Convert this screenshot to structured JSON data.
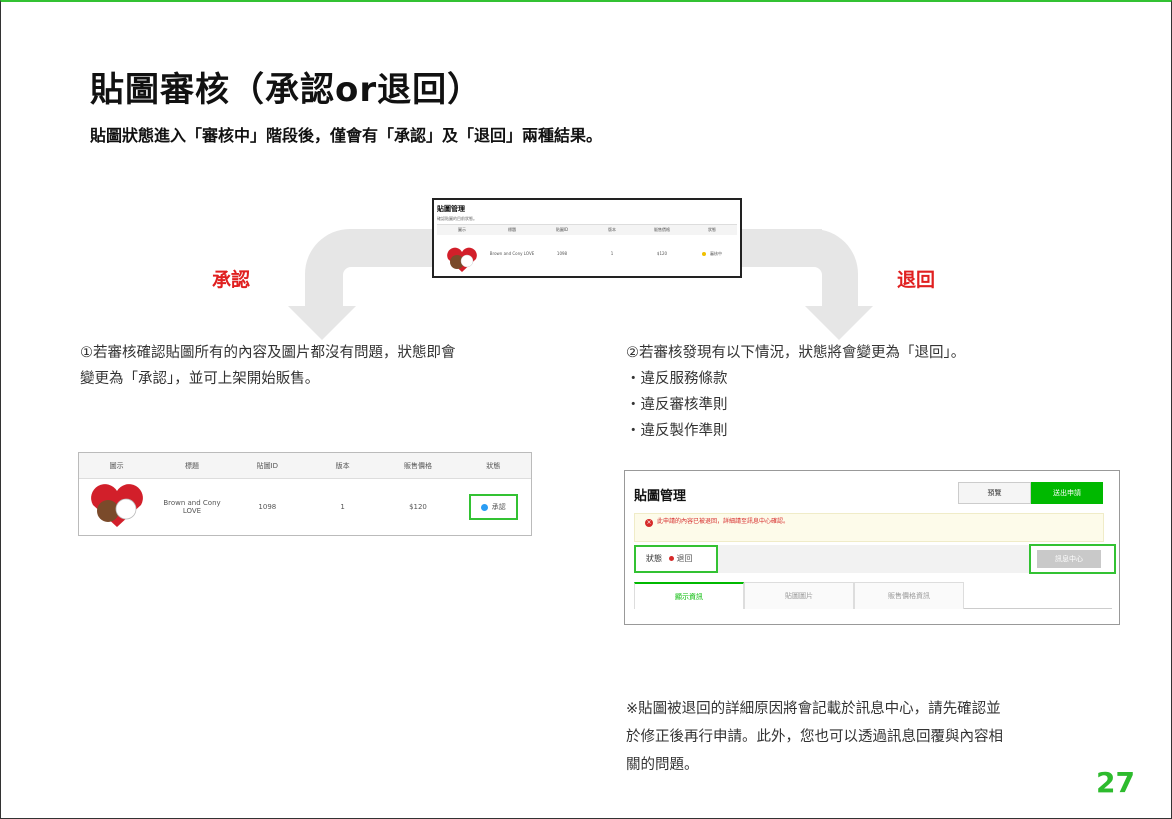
{
  "title": "貼圖審核（承認or退回）",
  "subtitle": "貼圖狀態進入「審核中」階段後，僅會有「承認」及「退回」兩種結果。",
  "approve_label": "承認",
  "reject_label": "退回",
  "approve_text": [
    "①若審核確認貼圖所有的內容及圖片都沒有問題，狀態即會",
    "變更為「承認」，並可上架開始販售。"
  ],
  "reject_text": [
    "②若審核發現有以下情況，狀態將會變更為「退回」。",
    "・違反服務條款",
    "・違反審核準則",
    "・違反製作準則"
  ],
  "mini_panel": {
    "title": "貼圖管理",
    "subtitle": "確認貼圖的目前狀態。",
    "columns": [
      "圖示",
      "標題",
      "貼圖ID",
      "版本",
      "販售價格",
      "狀態"
    ],
    "row": [
      "",
      "Brown and Cony LOVE",
      "1098",
      "1",
      "$120",
      "審核中"
    ]
  },
  "approved_table": {
    "columns": [
      "圖示",
      "標題",
      "貼圖ID",
      "版本",
      "販售價格",
      "狀態"
    ],
    "row": [
      "",
      "Brown and Cony LOVE",
      "1098",
      "1",
      "$120"
    ],
    "status": "承認",
    "status_color": "#2a9df4"
  },
  "rejected_panel": {
    "title": "貼圖管理",
    "preview_button": "預覽",
    "submit_button": "送出申請",
    "alert": "此申請的內容已被退回，詳細請至訊息中心確認。",
    "status_label": "狀態",
    "status_value": "退回",
    "status_color": "#d62a2a",
    "message_button": "訊息中心",
    "tabs": [
      "顯示資訊",
      "貼圖圖片",
      "販售價格資訊"
    ]
  },
  "note": [
    "※貼圖被退回的詳細原因將會記載於訊息中心，請先確認並",
    "於修正後再行申請。此外，您也可以透過訊息回覆與內容相",
    "關的問題。"
  ],
  "page_number": "27",
  "colors": {
    "accent": "#2dbb2d",
    "red": "#e02020"
  }
}
